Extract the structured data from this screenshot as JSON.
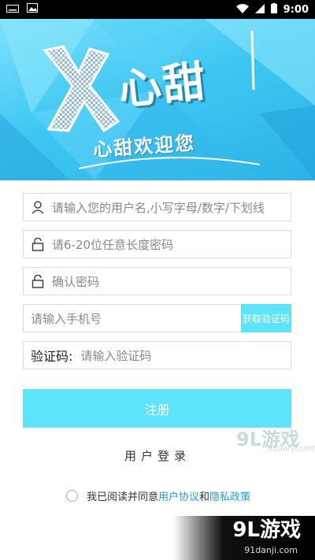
{
  "status_bar": {
    "time": "9:00"
  },
  "banner": {
    "logo_main": "心甜",
    "logo_sub": "心甜欢迎您"
  },
  "form": {
    "username_placeholder": "请输入您的用户名,小写字母/数字/下划线",
    "password_placeholder": "请6-20位任意长度密码",
    "confirm_placeholder": "确认密码",
    "phone_placeholder": "请输入手机号",
    "get_code_label": "获取验证码",
    "code_label": "验证码:",
    "code_placeholder": "请输入验证码"
  },
  "register_label": "注册",
  "login_label": "用户登录",
  "agreement": {
    "prefix": "我已阅读并同意",
    "user_agreement": "用户协议",
    "and": "和",
    "privacy": "隐私政策"
  },
  "watermark": {
    "brand": "9L游戏",
    "url": "91danji.com"
  },
  "colors": {
    "accent": "#5de4fb",
    "link": "#1aa3d6"
  }
}
